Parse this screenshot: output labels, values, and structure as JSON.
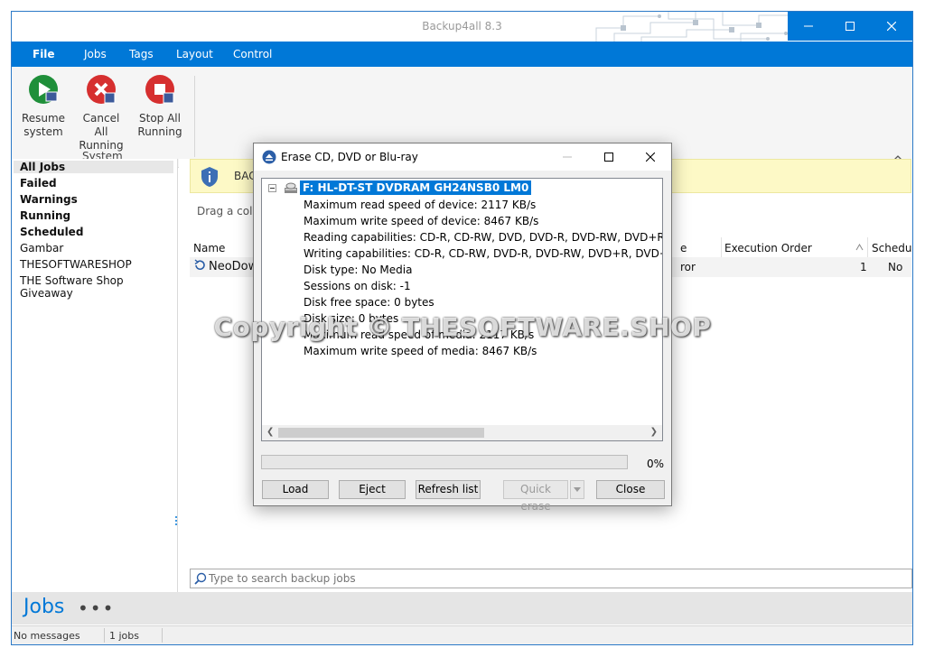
{
  "window": {
    "title": "Backup4all 8.3"
  },
  "menu": {
    "items": [
      "File",
      "Jobs",
      "Tags",
      "Layout",
      "Control"
    ]
  },
  "ribbon": {
    "buttons": [
      {
        "line1": "Resume",
        "line2": "system",
        "icon": "play-icon"
      },
      {
        "line1": "Cancel All",
        "line2": "Running",
        "icon": "cancel-icon"
      },
      {
        "line1": "Stop All",
        "line2": "Running",
        "icon": "stop-icon"
      }
    ],
    "group_label": "System"
  },
  "sidebar": {
    "items": [
      {
        "label": "All Jobs",
        "bold": true,
        "selected": true
      },
      {
        "label": "Failed",
        "bold": true
      },
      {
        "label": "Warnings",
        "bold": true
      },
      {
        "label": "Running",
        "bold": true
      },
      {
        "label": "Scheduled",
        "bold": true
      },
      {
        "label": "Gambar",
        "bold": false
      },
      {
        "label": "THESOFTWARESHOP",
        "bold": false
      },
      {
        "label": "THE Software Shop Giveaway",
        "bold": false
      }
    ]
  },
  "main": {
    "banner_text": "BAC",
    "drag_hint": "Drag a colu",
    "columns": {
      "name": "Name",
      "partial": "e",
      "execution_order": "Execution Order",
      "scheduled": "Scheduled"
    },
    "rows": [
      {
        "name": "NeoDow",
        "status": "ror",
        "order": "1",
        "scheduled": "No"
      }
    ],
    "search_placeholder": "Type to search backup jobs"
  },
  "bottom": {
    "jobs_label": "Jobs",
    "more": "•••"
  },
  "status": {
    "messages": "No messages",
    "jobs_count": "1 jobs"
  },
  "dialog": {
    "title": "Erase CD, DVD or Blu-ray",
    "drive": "F: HL-DT-ST DVDRAM GH24NSB0 LM0",
    "details": [
      "Maximum read speed of device: 2117 KB/s",
      "Maximum write speed of device: 8467 KB/s",
      "Reading capabilities: CD-R, CD-RW, DVD, DVD-R, DVD-RW, DVD+R, DVD+RW",
      "Writing capabilities: CD-R, CD-RW, DVD-R, DVD-RW, DVD+R, DVD+RW, DVD",
      "Disk type: No Media",
      "Sessions on disk: -1",
      "Disk free space: 0 bytes",
      "Disk size: 0 bytes",
      "Maximum read speed of media: 2117 KB/s",
      "Maximum write speed of media: 8467 KB/s"
    ],
    "progress_pct": "0%",
    "buttons": {
      "load": "Load",
      "eject": "Eject",
      "refresh": "Refresh list",
      "quick_erase": "Quick erase",
      "close": "Close"
    }
  },
  "watermark": "Copyright © THESOFTWARE.SHOP",
  "colors": {
    "accent": "#0078d7",
    "banner": "#fdf9c6"
  }
}
